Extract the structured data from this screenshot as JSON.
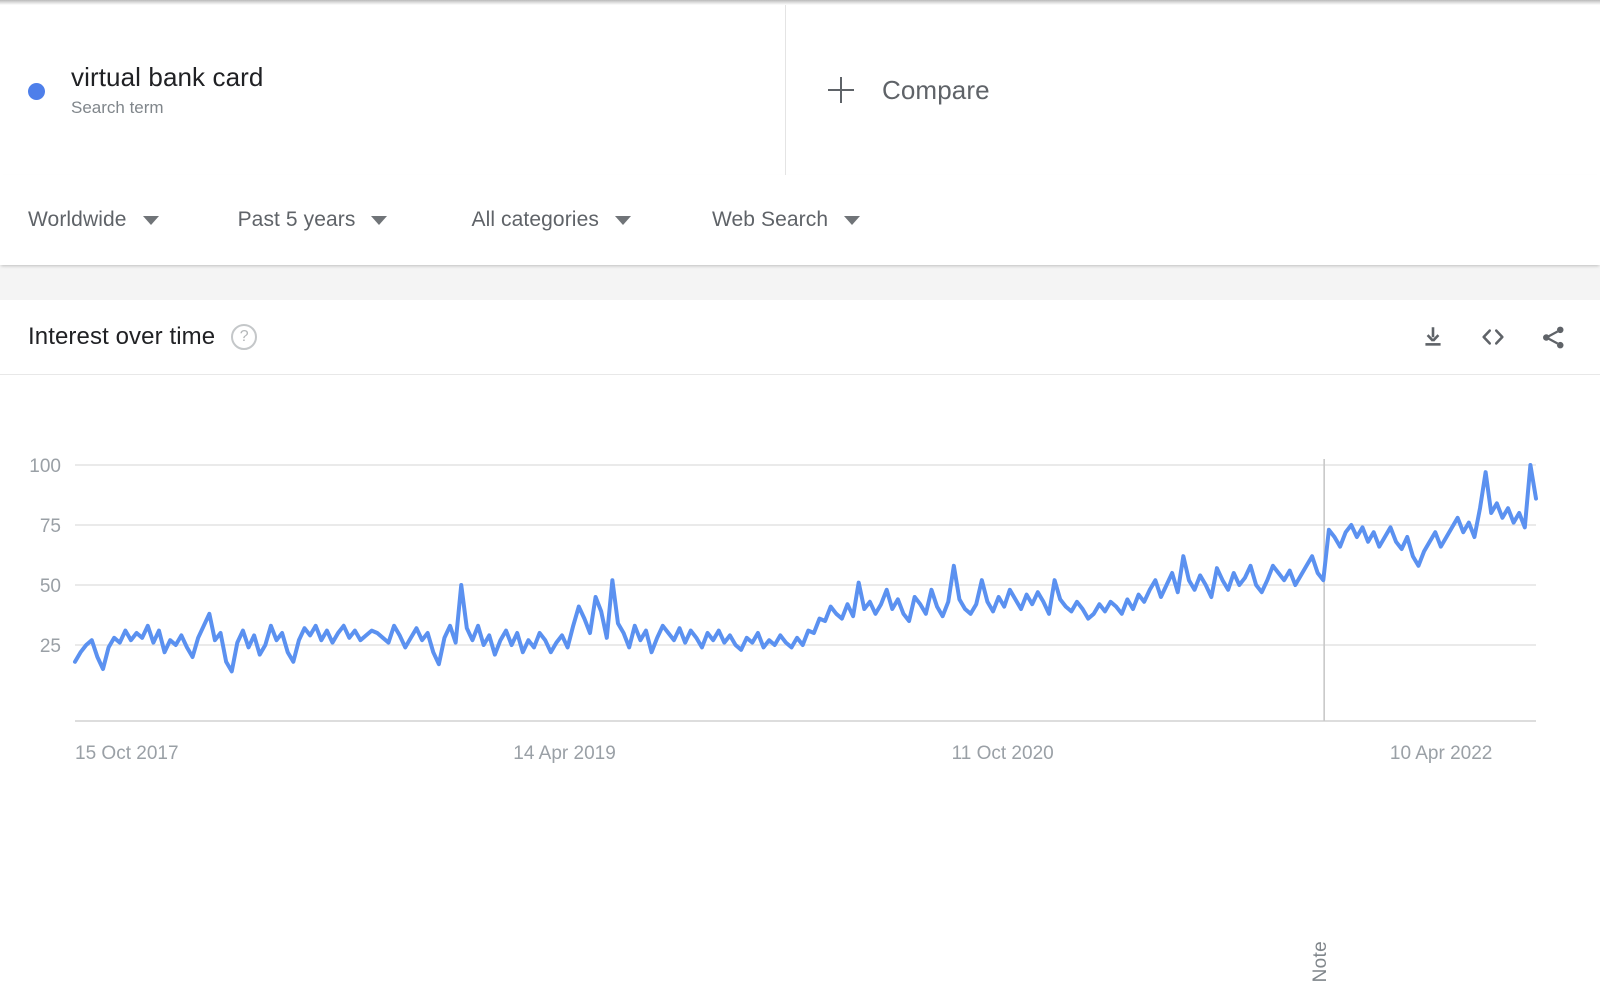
{
  "header": {
    "term": {
      "label": "virtual bank card",
      "sublabel": "Search term",
      "dot_color": "#4e7fea"
    },
    "compare": {
      "label": "Compare",
      "icon": "plus-icon"
    }
  },
  "filters": [
    {
      "label": "Worldwide",
      "icon": "chevron-down-icon"
    },
    {
      "label": "Past 5 years",
      "icon": "chevron-down-icon"
    },
    {
      "label": "All categories",
      "icon": "chevron-down-icon"
    },
    {
      "label": "Web Search",
      "icon": "chevron-down-icon"
    }
  ],
  "card": {
    "title": "Interest over time",
    "help_icon": "help-circle-icon",
    "help_glyph": "?",
    "actions": [
      {
        "name": "download-icon",
        "tooltip": "Download"
      },
      {
        "name": "embed-code-icon",
        "tooltip": "Embed"
      },
      {
        "name": "share-icon",
        "tooltip": "Share"
      }
    ]
  },
  "chart_data": {
    "type": "line",
    "title": "Interest over time",
    "xlabel": "",
    "ylabel": "",
    "ylim": [
      0,
      100
    ],
    "yticks": [
      25,
      50,
      75,
      100
    ],
    "grid": true,
    "legend": [
      "virtual bank card"
    ],
    "series_color": "#5b91f0",
    "tick_labels": [
      "15 Oct 2017",
      "14 Apr 2019",
      "11 Oct 2020",
      "10 Apr 2022"
    ],
    "tick_positions": [
      0,
      0.3,
      0.6,
      0.9
    ],
    "annotations": [
      {
        "label": "Note",
        "x_fraction": 0.855
      }
    ],
    "x_start": "15 Oct 2017",
    "x_end": "09 Oct 2022",
    "interval": "weekly",
    "series": [
      {
        "name": "virtual bank card",
        "values": [
          18,
          22,
          25,
          27,
          20,
          15,
          24,
          28,
          26,
          31,
          27,
          30,
          28,
          33,
          26,
          31,
          22,
          27,
          25,
          29,
          24,
          20,
          28,
          33,
          38,
          27,
          30,
          18,
          14,
          26,
          31,
          24,
          29,
          21,
          25,
          33,
          27,
          30,
          22,
          18,
          27,
          32,
          29,
          33,
          27,
          31,
          26,
          30,
          33,
          28,
          31,
          27,
          29,
          31,
          30,
          28,
          26,
          33,
          29,
          24,
          28,
          32,
          27,
          30,
          22,
          17,
          28,
          33,
          26,
          50,
          32,
          27,
          33,
          25,
          29,
          21,
          27,
          31,
          25,
          30,
          22,
          27,
          24,
          30,
          27,
          22,
          26,
          29,
          24,
          33,
          41,
          36,
          30,
          45,
          39,
          28,
          52,
          34,
          30,
          24,
          33,
          27,
          31,
          22,
          28,
          33,
          30,
          27,
          32,
          26,
          31,
          28,
          24,
          30,
          27,
          31,
          26,
          29,
          25,
          23,
          28,
          26,
          30,
          24,
          27,
          25,
          29,
          26,
          24,
          28,
          25,
          31,
          30,
          36,
          35,
          41,
          38,
          36,
          42,
          37,
          51,
          40,
          43,
          38,
          42,
          48,
          40,
          44,
          38,
          35,
          45,
          42,
          38,
          48,
          41,
          37,
          43,
          58,
          44,
          40,
          38,
          42,
          52,
          43,
          39,
          45,
          41,
          48,
          44,
          40,
          46,
          42,
          47,
          43,
          38,
          52,
          44,
          41,
          39,
          43,
          40,
          36,
          38,
          42,
          39,
          43,
          41,
          38,
          44,
          40,
          46,
          43,
          48,
          52,
          45,
          50,
          55,
          47,
          62,
          52,
          48,
          54,
          50,
          45,
          57,
          52,
          48,
          55,
          50,
          53,
          58,
          50,
          47,
          52,
          58,
          55,
          52,
          56,
          50,
          54,
          58,
          62,
          55,
          52,
          73,
          70,
          66,
          72,
          75,
          70,
          74,
          68,
          72,
          66,
          70,
          74,
          68,
          65,
          70,
          62,
          58,
          64,
          68,
          72,
          66,
          70,
          74,
          78,
          72,
          76,
          70,
          82,
          97,
          80,
          84,
          78,
          82,
          76,
          80,
          74,
          100,
          86
        ]
      }
    ]
  }
}
